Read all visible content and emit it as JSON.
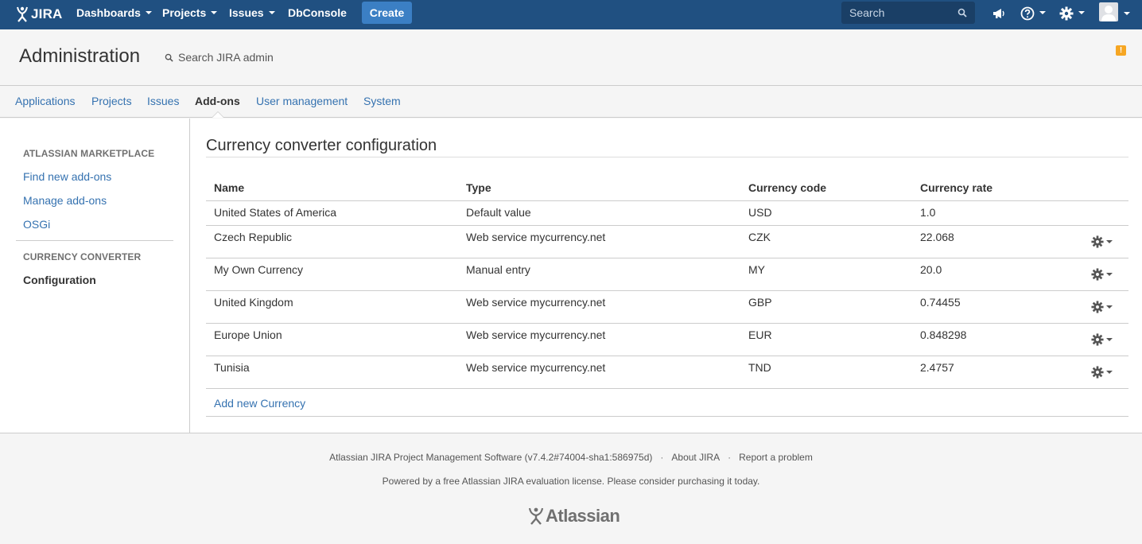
{
  "topnav": {
    "logo_text": "JIRA",
    "menu": [
      {
        "label": "Dashboards",
        "has_caret": true
      },
      {
        "label": "Projects",
        "has_caret": true
      },
      {
        "label": "Issues",
        "has_caret": true
      },
      {
        "label": "DbConsole",
        "has_caret": false
      }
    ],
    "create_label": "Create",
    "search_placeholder": "Search",
    "icons": [
      "announcement-icon",
      "help-icon",
      "settings-icon",
      "user-avatar"
    ],
    "bg_color": "#205081",
    "create_color": "#3b7fc4"
  },
  "header": {
    "title": "Administration",
    "search_label": "Search JIRA admin",
    "warning_glyph": "!"
  },
  "tabs": [
    {
      "label": "Applications",
      "active": false
    },
    {
      "label": "Projects",
      "active": false
    },
    {
      "label": "Issues",
      "active": false
    },
    {
      "label": "Add-ons",
      "active": true
    },
    {
      "label": "User management",
      "active": false
    },
    {
      "label": "System",
      "active": false
    }
  ],
  "sidebar": {
    "section1_heading": "ATLASSIAN MARKETPLACE",
    "section1_links": [
      "Find new add-ons",
      "Manage add-ons",
      "OSGi"
    ],
    "section2_heading": "CURRENCY CONVERTER",
    "section2_links": [
      "Configuration"
    ]
  },
  "content": {
    "title": "Currency converter configuration",
    "columns": [
      "Name",
      "Type",
      "Currency code",
      "Currency rate"
    ],
    "rows": [
      {
        "name": "United States of America",
        "type": "Default value",
        "code": "USD",
        "rate": "1.0",
        "has_actions": false
      },
      {
        "name": "Czech Republic",
        "type": "Web service mycurrency.net",
        "code": "CZK",
        "rate": "22.068",
        "has_actions": true
      },
      {
        "name": "My Own Currency",
        "type": "Manual entry",
        "code": "MY",
        "rate": "20.0",
        "has_actions": true
      },
      {
        "name": "United Kingdom",
        "type": "Web service mycurrency.net",
        "code": "GBP",
        "rate": "0.74455",
        "has_actions": true
      },
      {
        "name": "Europe Union",
        "type": "Web service mycurrency.net",
        "code": "EUR",
        "rate": "0.848298",
        "has_actions": true
      },
      {
        "name": "Tunisia",
        "type": "Web service mycurrency.net",
        "code": "TND",
        "rate": "2.4757",
        "has_actions": true
      }
    ],
    "add_link": "Add new Currency"
  },
  "footer": {
    "version_text": "Atlassian JIRA Project Management Software (v7.4.2#74004-sha1:586975d)",
    "about_link": "About JIRA",
    "report_link": "Report a problem",
    "separator": "·",
    "license_text": "Powered by a free Atlassian JIRA evaluation license. Please consider purchasing it today.",
    "logo_text": "Atlassian"
  }
}
